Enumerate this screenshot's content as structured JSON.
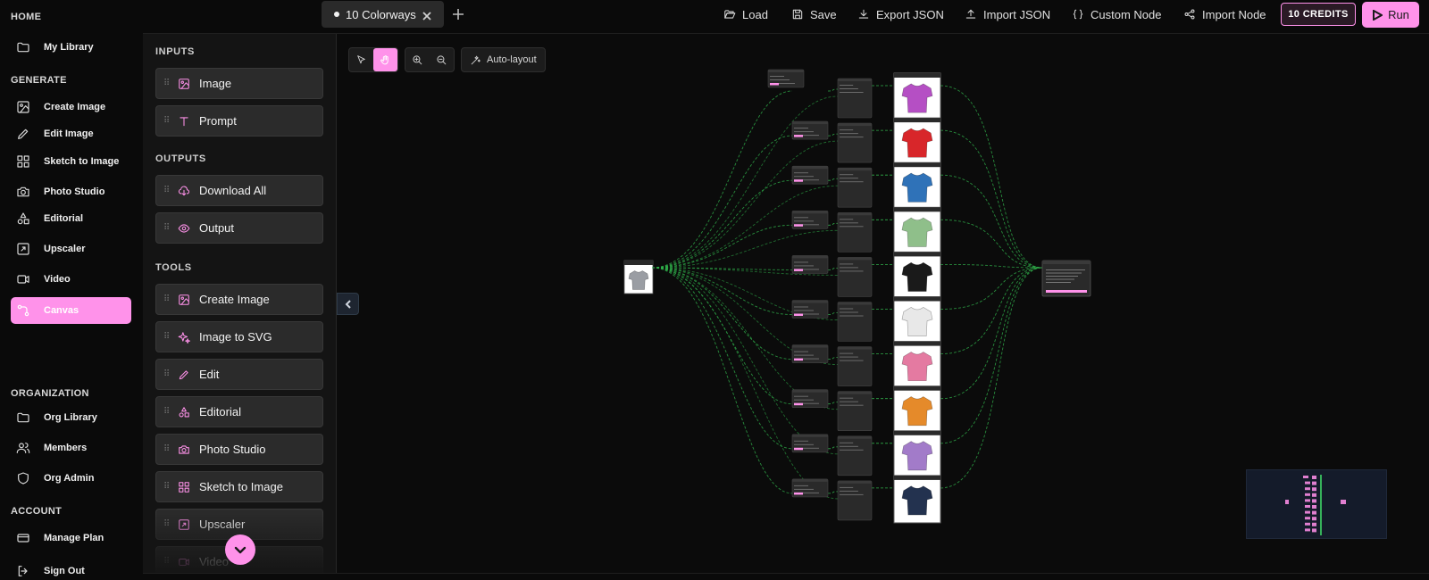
{
  "nav": {
    "sections": {
      "home": "HOME",
      "generate": "GENERATE",
      "organization": "ORGANIZATION",
      "account": "ACCOUNT"
    },
    "items": {
      "my_library": "My Library",
      "create_image": "Create Image",
      "edit_image": "Edit Image",
      "sketch_to_image": "Sketch to Image",
      "photo_studio": "Photo Studio",
      "editorial": "Editorial",
      "upscaler": "Upscaler",
      "video": "Video",
      "canvas": "Canvas",
      "org_library": "Org Library",
      "members": "Members",
      "org_admin": "Org Admin",
      "manage_plan": "Manage Plan",
      "sign_out": "Sign Out"
    },
    "active_item": "canvas"
  },
  "palette": {
    "sections": {
      "inputs": "INPUTS",
      "outputs": "OUTPUTS",
      "tools": "TOOLS"
    },
    "inputs": [
      "Image",
      "Prompt"
    ],
    "outputs": [
      "Download All",
      "Output"
    ],
    "tools": [
      "Create Image",
      "Image to SVG",
      "Edit",
      "Editorial",
      "Photo Studio",
      "Sketch to Image",
      "Upscaler",
      "Video"
    ]
  },
  "topbar": {
    "tab_title": "10 Colorways",
    "buttons": {
      "load": "Load",
      "save": "Save",
      "export_json": "Export JSON",
      "import_json": "Import JSON",
      "custom_node": "Custom Node",
      "import_node": "Import Node"
    },
    "credits": "10 CREDITS",
    "run": "Run"
  },
  "canvas_toolbar": {
    "auto_layout": "Auto-layout",
    "active_tool": "pan"
  },
  "graph": {
    "colorway_count": 10,
    "colorways": [
      "#b54fc4",
      "#d8262a",
      "#2f72b8",
      "#8fbf8a",
      "#1a1a1a",
      "#e8e8e8",
      "#e47aa1",
      "#e58a2a",
      "#a27bc9",
      "#23324f"
    ],
    "source_shirt_color": "#9a9da3",
    "edge_color": "#2fae4a"
  },
  "colors": {
    "accent": "#ff92ea",
    "background": "#0a0a0a",
    "panel": "#141414"
  }
}
